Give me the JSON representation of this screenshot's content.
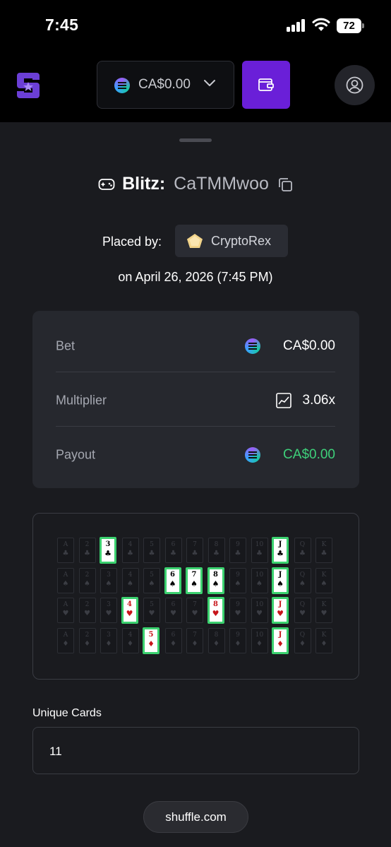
{
  "status_bar": {
    "time": "7:45",
    "battery": "72"
  },
  "header": {
    "balance": "CA$0.00",
    "coin_icon": "solana-coin-icon",
    "brand_color": "#6a1fd8"
  },
  "bet": {
    "game": "Blitz:",
    "id": "CaTMMwoo",
    "placed_by_label": "Placed by:",
    "user": "CryptoRex",
    "date": "on April 26, 2026 (7:45 PM)"
  },
  "stats": {
    "bet_label": "Bet",
    "bet_value": "CA$0.00",
    "multiplier_label": "Multiplier",
    "multiplier_value": "3.06x",
    "payout_label": "Payout",
    "payout_value": "CA$0.00",
    "payout_color": "#3ed07a"
  },
  "deck": {
    "ranks": [
      "A",
      "2",
      "3",
      "4",
      "5",
      "6",
      "7",
      "8",
      "9",
      "10",
      "J",
      "Q",
      "K"
    ],
    "suits": [
      {
        "name": "clubs",
        "symbol": "♣",
        "color": "black"
      },
      {
        "name": "spades",
        "symbol": "♠",
        "color": "black"
      },
      {
        "name": "hearts",
        "symbol": "♥",
        "color": "red"
      },
      {
        "name": "diamonds",
        "symbol": "♦",
        "color": "red"
      }
    ],
    "selected": [
      [
        "3",
        "J"
      ],
      [
        "6",
        "7",
        "8",
        "J"
      ],
      [
        "4",
        "8",
        "J"
      ],
      [
        "5",
        "J"
      ]
    ]
  },
  "unique_cards": {
    "label": "Unique Cards",
    "value": "11"
  },
  "footer": {
    "domain": "shuffle.com"
  }
}
